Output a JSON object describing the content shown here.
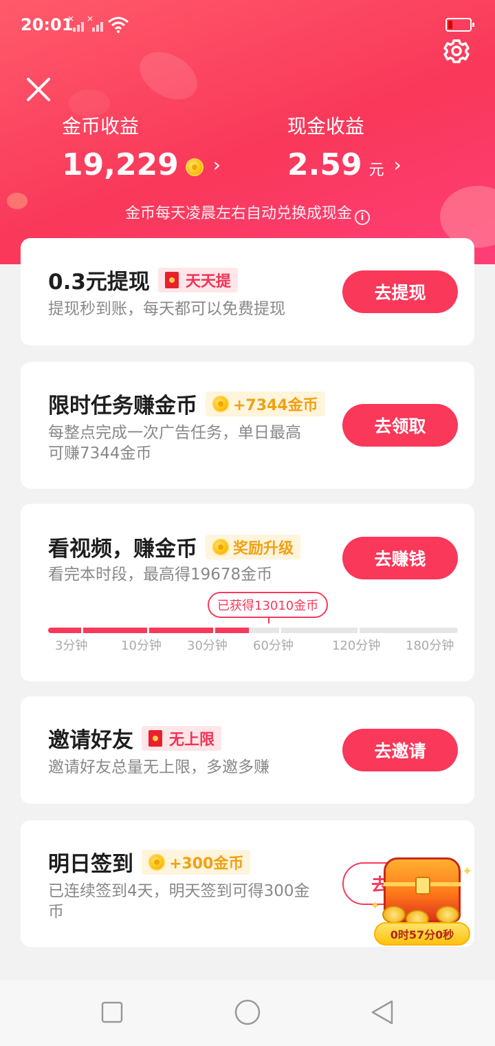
{
  "status_bar": {
    "time": "20:01"
  },
  "header": {
    "coin_label": "金币收益",
    "coin_value": "19,229",
    "cash_label": "现金收益",
    "cash_value": "2.59",
    "cash_unit": "元",
    "notice": "金币每天凌晨左右自动兑换成现金"
  },
  "cards": {
    "withdraw": {
      "title": "0.3元提现",
      "badge": "天天提",
      "desc": "提现秒到账，每天都可以免费提现",
      "button": "去提现"
    },
    "limited_task": {
      "title": "限时任务赚金币",
      "badge": "+7344金币",
      "desc_line1": "每整点完成一次广告任务，单日最高",
      "desc_line2": "可赚7344金币",
      "button": "去领取"
    },
    "video": {
      "title": "看视频，赚金币",
      "badge": "奖励升级",
      "desc": "看完本时段，最高得19678金币",
      "button": "去赚钱",
      "progress_tip": "已获得13010金币",
      "progress_fraction": 0.49,
      "ticks": [
        "3分钟",
        "10分钟",
        "30分钟",
        "60分钟",
        "120分钟",
        "180分钟"
      ]
    },
    "invite": {
      "title": "邀请好友",
      "badge": "无上限",
      "desc": "邀请好友总量无上限，多邀多赚",
      "button": "去邀请"
    },
    "signin": {
      "title": "明日签到",
      "badge": "+300金币",
      "desc_line1": "已连续签到4天，明天签到可得300金",
      "desc_line2": "币",
      "button": "去"
    }
  },
  "chest": {
    "timer": "0时57分0秒"
  },
  "colors": {
    "accent": "#f9385a",
    "gold": "#f0a113",
    "background": "#f2f2f2"
  }
}
